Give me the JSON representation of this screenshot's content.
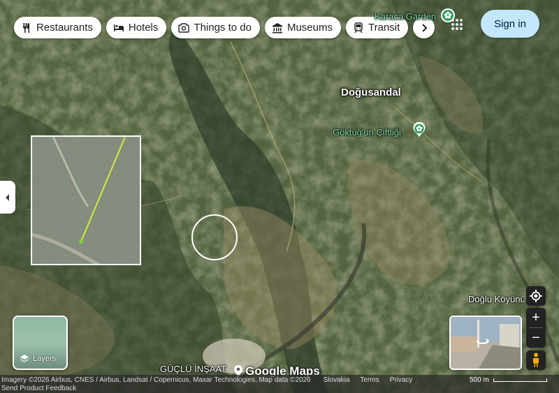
{
  "chips": [
    {
      "label": "Restaurants",
      "icon": "restaurant-icon"
    },
    {
      "label": "Hotels",
      "icon": "hotel-icon"
    },
    {
      "label": "Things to do",
      "icon": "camera-icon"
    },
    {
      "label": "Museums",
      "icon": "museum-icon"
    },
    {
      "label": "Transit",
      "icon": "transit-icon"
    }
  ],
  "chips_more_icon": "chevron-right-icon",
  "sign_in": "Sign in",
  "apps_icon": "apps-grid-icon",
  "map": {
    "places": {
      "karaca_garden": "Karaca Garden",
      "dogusandal": "Doğusandal",
      "goktug": "Göktuğ'un Çiftliği",
      "doglu": "Doğlu Köyünü Yürüyüş Parkurları",
      "guclu": "GÜÇLÜ İNŞAAT"
    },
    "colors": {
      "park_green": "#2e9e5b",
      "accent_blue": "#c2e7ff",
      "label_white": "#ffffff"
    }
  },
  "layers": {
    "label": "Layers",
    "icon": "layers-icon"
  },
  "controls": {
    "locate_icon": "my-location-icon",
    "zoom_in": "+",
    "zoom_out": "−",
    "pegman_icon": "pegman-icon",
    "collapse_icon": "chevron-left-icon"
  },
  "footer": {
    "logo": "Google Maps",
    "attribution": "Imagery ©2026 Airbus, CNES / Airbus, Landsat / Copernicus, Maxar Technologies, Map data ©2026",
    "country": "Slovakia",
    "terms": "Terms",
    "privacy": "Privacy",
    "scale": "500 m",
    "feedback": "Send Product Feedback"
  }
}
